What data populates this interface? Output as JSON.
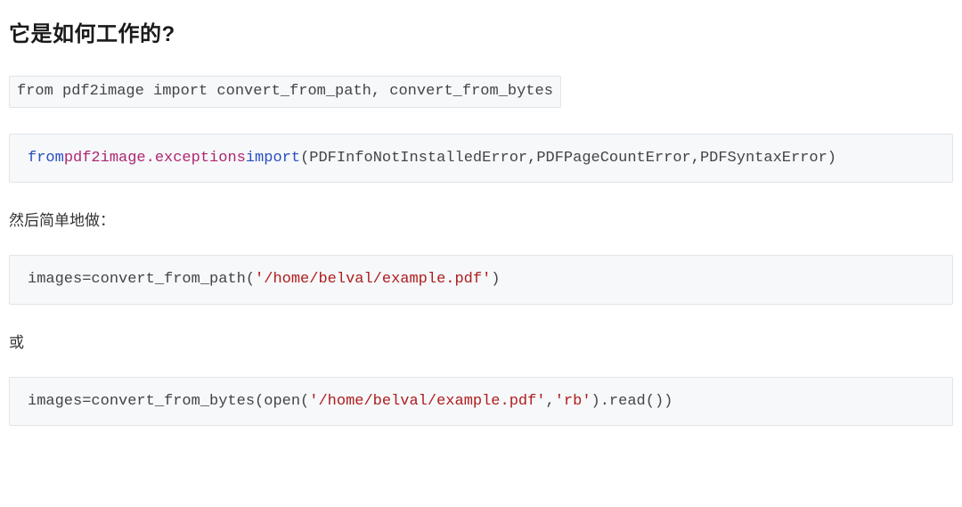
{
  "heading": "它是如何工作的?",
  "code1": {
    "line": "from pdf2image import convert_from_path, convert_from_bytes"
  },
  "code2": {
    "kw1": "from",
    "mod": "pdf2image.exceptions",
    "kw2": "import",
    "rest": "(PDFInfoNotInstalledError,PDFPageCountError,PDFSyntaxError)"
  },
  "para1": "然后简单地做：",
  "code3": {
    "prefix": "images=convert_from_path(",
    "str": "'/home/belval/example.pdf'",
    "suffix": ")"
  },
  "para2": "或",
  "code4": {
    "prefix": "images=convert_from_bytes(open(",
    "str1": "'/home/belval/example.pdf'",
    "mid": ",",
    "str2": "'rb'",
    "suffix": ").read())"
  }
}
